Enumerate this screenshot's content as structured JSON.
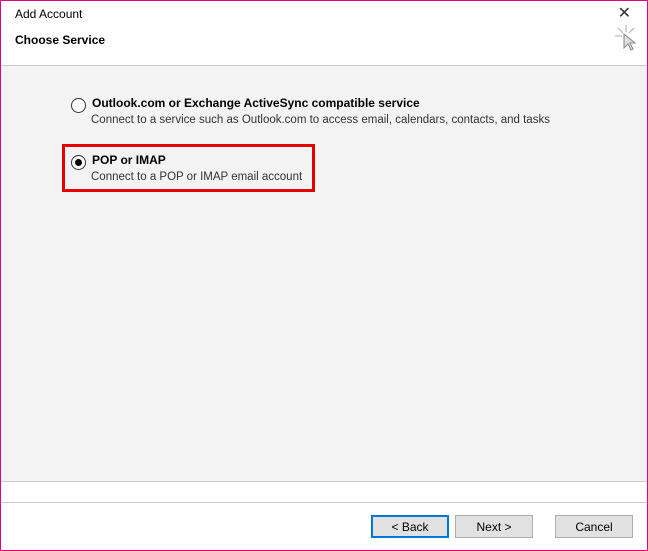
{
  "titlebar": {
    "title": "Add Account"
  },
  "header": {
    "subtitle": "Choose Service"
  },
  "options": {
    "outlook": {
      "title": "Outlook.com or Exchange ActiveSync compatible service",
      "desc": "Connect to a service such as Outlook.com to access email, calendars, contacts, and tasks",
      "selected": false
    },
    "pop": {
      "title": "POP or IMAP",
      "desc": "Connect to a POP or IMAP email account",
      "selected": true
    }
  },
  "footer": {
    "back": "< Back",
    "next": "Next >",
    "cancel": "Cancel"
  }
}
